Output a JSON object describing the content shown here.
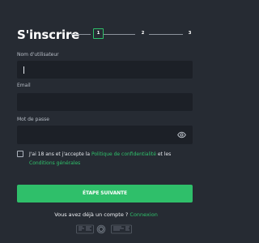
{
  "header": {
    "title": "S'inscrire",
    "steps": [
      "1",
      "2",
      "3"
    ]
  },
  "form": {
    "username": {
      "label": "Nom d'utilisateur",
      "value": ""
    },
    "email": {
      "label": "Email",
      "value": ""
    },
    "password": {
      "label": "Mot de passe",
      "value": ""
    },
    "consent": {
      "prefix": "J'ai 18 ans et j'accepte la ",
      "privacy_link": "Politique de confidentialité",
      "middle": " et les",
      "terms_link": "Conditions générales"
    },
    "next_button": "ÉTAPE SUIVANTE"
  },
  "login": {
    "prompt": "Vous avez déjà un compte ?",
    "link": "Connexion"
  },
  "icons": {
    "eye": "eye-icon",
    "checkbox": "checkbox-icon",
    "badge_one": "certification-badge-icon",
    "badge_two": "seal-badge-icon",
    "badge_three": "responsible-gaming-badge-icon"
  },
  "colors": {
    "background": "#262b33",
    "field": "#1c2027",
    "accent": "#2fbf6a",
    "text": "#ffffff"
  }
}
